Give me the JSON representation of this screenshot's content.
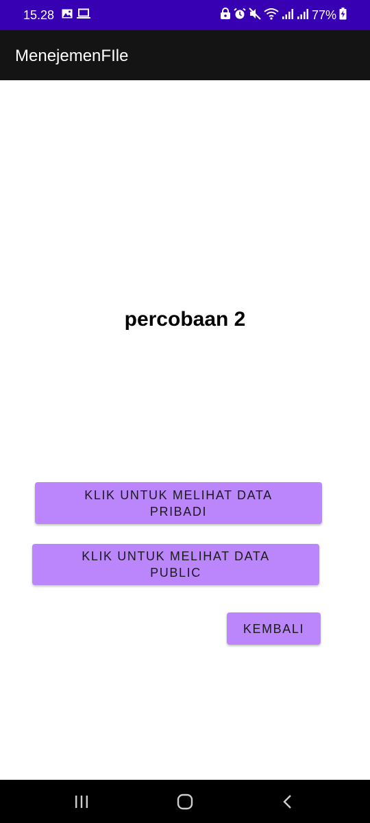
{
  "status_bar": {
    "time": "15.28",
    "battery": "77%",
    "background": "#3700b3",
    "left_icons": [
      "image-icon",
      "laptop-icon"
    ],
    "right_icons": [
      "lock-icon",
      "alarm-icon",
      "mute-icon",
      "wifi-icon",
      "signal-icon",
      "signal-icon",
      "battery-icon"
    ]
  },
  "app_bar": {
    "title": "MenejemenFIle",
    "background": "#141414"
  },
  "main": {
    "heading": "percobaan 2",
    "buttons": {
      "pribadi_line1": "KLIK UNTUK MELIHAT DATA",
      "pribadi_line2": "PRIBADI",
      "public_line1": "KLIK UNTUK MELIHAT DATA",
      "public_line2": "PUBLIC",
      "kembali": "KEMBALI"
    },
    "button_color": "#bb86fc"
  },
  "nav_bar": {
    "icons": [
      "recents-icon",
      "home-icon",
      "back-icon"
    ]
  }
}
